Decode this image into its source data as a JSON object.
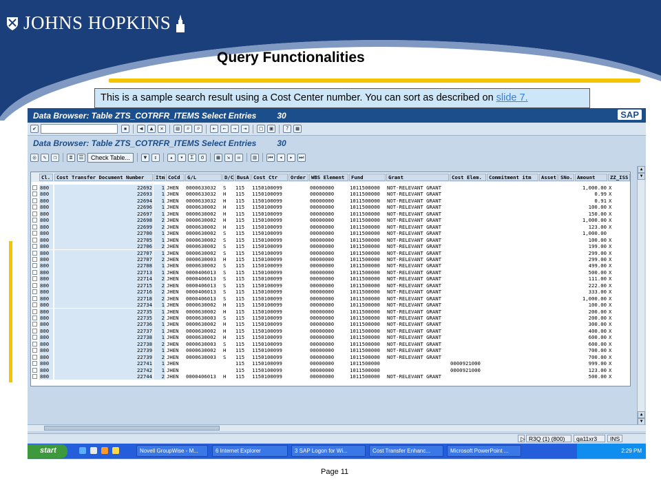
{
  "header": {
    "logo_text": "JOHNS HOPKINS",
    "title": "Query Functionalities",
    "callout_text": "This is a sample search result using a Cost Center number. You can sort as described on ",
    "callout_link": "slide 7."
  },
  "sap": {
    "window_title": "Data Browser: Table ZTS_COTRFR_ITEMS Select Entries",
    "window_count": "30",
    "sap_logo": "SAP",
    "subtitle": "Data Browser: Table ZTS_COTRFR_ITEMS Select Entries",
    "subtitle_count": "30",
    "check_table_label": "Check Table...",
    "columns": [
      "Cl.",
      "Cost Transfer Document Number",
      "Itm",
      "CoCd",
      "G/L",
      "D/C",
      "BusA",
      "Cost Ctr",
      "Order",
      "WBS Element",
      "Fund",
      "Grant",
      "Cost Elem.",
      "Commitment itm",
      "Asset",
      "SNo.",
      "Amount",
      "ZZ_ISS"
    ],
    "rows": [
      [
        "800",
        "22692",
        "1",
        "JHEN",
        "0000633032",
        "S",
        "115",
        "1150100099",
        "",
        "00000000",
        "1011500000",
        "NOT-RELEVANT GRANT",
        "",
        "",
        "",
        "",
        "1,000.00",
        "X"
      ],
      [
        "800",
        "22693",
        "1",
        "JHEN",
        "0000633032",
        "H",
        "115",
        "1150100099",
        "",
        "00000000",
        "1011500000",
        "NOT-RELEVANT GRANT",
        "",
        "",
        "",
        "",
        "0.99",
        "X"
      ],
      [
        "800",
        "22694",
        "1",
        "JHEN",
        "0000633032",
        "H",
        "115",
        "1150100099",
        "",
        "00000000",
        "1011500000",
        "NOT-RELEVANT GRANT",
        "",
        "",
        "",
        "",
        "0.91",
        "X"
      ],
      [
        "800",
        "22696",
        "1",
        "JHEN",
        "0000630002",
        "H",
        "115",
        "1150100099",
        "",
        "00000000",
        "1011500000",
        "NOT-RELEVANT GRANT",
        "",
        "",
        "",
        "",
        "100.00",
        "X"
      ],
      [
        "800",
        "22697",
        "1",
        "JHEN",
        "0000630002",
        "H",
        "115",
        "1150100099",
        "",
        "00000000",
        "1011500000",
        "NOT-RELEVANT GRANT",
        "",
        "",
        "",
        "",
        "150.00",
        "X"
      ],
      [
        "800",
        "22698",
        "2",
        "JHEN",
        "0000630002",
        "H",
        "115",
        "1150100099",
        "",
        "00000000",
        "1011500000",
        "NOT-RELEVANT GRANT",
        "",
        "",
        "",
        "",
        "1,000.00",
        "X"
      ],
      [
        "800",
        "22699",
        "2",
        "JHEN",
        "0000630002",
        "H",
        "115",
        "1150100099",
        "",
        "00000000",
        "1011500000",
        "NOT-RELEVANT GRANT",
        "",
        "",
        "",
        "",
        "123.00",
        "X"
      ],
      [
        "800",
        "22700",
        "1",
        "JHEN",
        "0000630002",
        "S",
        "115",
        "1150100099",
        "",
        "00000000",
        "1011500000",
        "NOT-RELEVANT GRANT",
        "",
        "",
        "",
        "",
        "1,000.00",
        ""
      ],
      [
        "800",
        "22705",
        "1",
        "JHEN",
        "0000630002",
        "S",
        "115",
        "1150100099",
        "",
        "00000000",
        "1011500000",
        "NOT-RELEVANT GRANT",
        "",
        "",
        "",
        "",
        "100.00",
        "X"
      ],
      [
        "800",
        "22706",
        "2",
        "JHEN",
        "0000630002",
        "S",
        "115",
        "1150100099",
        "",
        "00000000",
        "1011500000",
        "NOT-RELEVANT GRANT",
        "",
        "",
        "",
        "",
        "199.00",
        "X"
      ],
      [
        "800",
        "22707",
        "1",
        "JHEN",
        "0000630002",
        "S",
        "115",
        "1150100099",
        "",
        "00000000",
        "1011500000",
        "NOT-RELEVANT GRANT",
        "",
        "",
        "",
        "",
        "299.00",
        "X"
      ],
      [
        "800",
        "22707",
        "2",
        "JHEN",
        "0000630003",
        "H",
        "115",
        "1150100099",
        "",
        "00000000",
        "1011500000",
        "NOT-RELEVANT GRANT",
        "",
        "",
        "",
        "",
        "299.00",
        "X"
      ],
      [
        "800",
        "22708",
        "1",
        "JHEN",
        "0000630002",
        "S",
        "115",
        "1150100099",
        "",
        "00000000",
        "1011500000",
        "NOT-RELEVANT GRANT",
        "",
        "",
        "",
        "",
        "499.00",
        "X"
      ],
      [
        "800",
        "22713",
        "1",
        "JHEN",
        "0000406013",
        "S",
        "115",
        "1150100099",
        "",
        "00000000",
        "1011500000",
        "NOT-RELEVANT GRANT",
        "",
        "",
        "",
        "",
        "500.00",
        "X"
      ],
      [
        "800",
        "22714",
        "2",
        "JHEN",
        "0000406013",
        "S",
        "115",
        "1150100099",
        "",
        "00000000",
        "1011500000",
        "NOT-RELEVANT GRANT",
        "",
        "",
        "",
        "",
        "111.00",
        "X"
      ],
      [
        "800",
        "22715",
        "2",
        "JHEN",
        "0000406013",
        "S",
        "115",
        "1150100099",
        "",
        "00000000",
        "1011500000",
        "NOT-RELEVANT GRANT",
        "",
        "",
        "",
        "",
        "222.00",
        "X"
      ],
      [
        "800",
        "22716",
        "2",
        "JHEN",
        "0000406013",
        "S",
        "115",
        "1150100099",
        "",
        "00000000",
        "1011500000",
        "NOT-RELEVANT GRANT",
        "",
        "",
        "",
        "",
        "333.00",
        "X"
      ],
      [
        "800",
        "22718",
        "2",
        "JHEN",
        "0000406013",
        "S",
        "115",
        "1150100099",
        "",
        "00000000",
        "1011500000",
        "NOT-RELEVANT GRANT",
        "",
        "",
        "",
        "",
        "1,000.00",
        "X"
      ],
      [
        "800",
        "22734",
        "1",
        "JHEN",
        "0000630002",
        "H",
        "115",
        "1150100099",
        "",
        "00000000",
        "1011500000",
        "NOT-RELEVANT GRANT",
        "",
        "",
        "",
        "",
        "100.00",
        "X"
      ],
      [
        "800",
        "22735",
        "1",
        "JHEN",
        "0000630002",
        "H",
        "115",
        "1150100099",
        "",
        "00000000",
        "1011500000",
        "NOT-RELEVANT GRANT",
        "",
        "",
        "",
        "",
        "200.00",
        "X"
      ],
      [
        "800",
        "22735",
        "2",
        "JHEN",
        "0000630003",
        "S",
        "115",
        "1150100099",
        "",
        "00000000",
        "1011500000",
        "NOT-RELEVANT GRANT",
        "",
        "",
        "",
        "",
        "200.00",
        "X"
      ],
      [
        "800",
        "22736",
        "1",
        "JHEN",
        "0000630002",
        "H",
        "115",
        "1150100099",
        "",
        "00000000",
        "1011500000",
        "NOT-RELEVANT GRANT",
        "",
        "",
        "",
        "",
        "300.00",
        "X"
      ],
      [
        "800",
        "22737",
        "1",
        "JHEN",
        "0000630002",
        "H",
        "115",
        "1150100099",
        "",
        "00000000",
        "1011500000",
        "NOT-RELEVANT GRANT",
        "",
        "",
        "",
        "",
        "400.00",
        "X"
      ],
      [
        "800",
        "22738",
        "1",
        "JHEN",
        "0000630002",
        "H",
        "115",
        "1150100099",
        "",
        "00000000",
        "1011500000",
        "NOT-RELEVANT GRANT",
        "",
        "",
        "",
        "",
        "600.00",
        "X"
      ],
      [
        "800",
        "22738",
        "2",
        "JHEN",
        "0000630003",
        "S",
        "115",
        "1150100099",
        "",
        "00000000",
        "1011500000",
        "NOT-RELEVANT GRANT",
        "",
        "",
        "",
        "",
        "600.00",
        "X"
      ],
      [
        "800",
        "22739",
        "1",
        "JHEN",
        "0000630002",
        "H",
        "115",
        "1150100099",
        "",
        "00000000",
        "1011500000",
        "NOT-RELEVANT GRANT",
        "",
        "",
        "",
        "",
        "700.00",
        "X"
      ],
      [
        "800",
        "22739",
        "2",
        "JHEN",
        "0000630003",
        "S",
        "115",
        "1150100099",
        "",
        "00000000",
        "1011500000",
        "NOT-RELEVANT GRANT",
        "",
        "",
        "",
        "",
        "700.00",
        "X"
      ],
      [
        "800",
        "22741",
        "1",
        "JHEN",
        "",
        "",
        "115",
        "1150100099",
        "",
        "00000000",
        "1011500000",
        "",
        "0000921000",
        "",
        "",
        "",
        "999.00",
        "X"
      ],
      [
        "800",
        "22742",
        "1",
        "JHEN",
        "",
        "",
        "115",
        "1150100099",
        "",
        "00000000",
        "1011500000",
        "",
        "0000921000",
        "",
        "",
        "",
        "123.00",
        "X"
      ],
      [
        "800",
        "22744",
        "2",
        "JHEN",
        "0000406013",
        "H",
        "115",
        "1150100099",
        "",
        "00000000",
        "1011500000",
        "NOT-RELEVANT GRANT",
        "",
        "",
        "",
        "",
        "500.00",
        "X"
      ]
    ],
    "status": {
      "system": "R3Q (1) (800)",
      "server": "qa11xr3",
      "mode": "INS"
    },
    "taskbar": {
      "start": "start",
      "tasks": [
        "Novell GroupWise - M...",
        "6 Internet Explorer",
        "3 SAP Logon for Wi...",
        "Cost Transfer Enhanc...",
        "Microsoft PowerPoint ..."
      ],
      "clock": "2:29 PM"
    }
  },
  "footer": {
    "page": "Page 11"
  },
  "colors": {
    "navy": "#1b3f7a",
    "gold": "#f5c400",
    "callout_bg": "#cde6f8",
    "sap_title": "#1b4e8a"
  }
}
